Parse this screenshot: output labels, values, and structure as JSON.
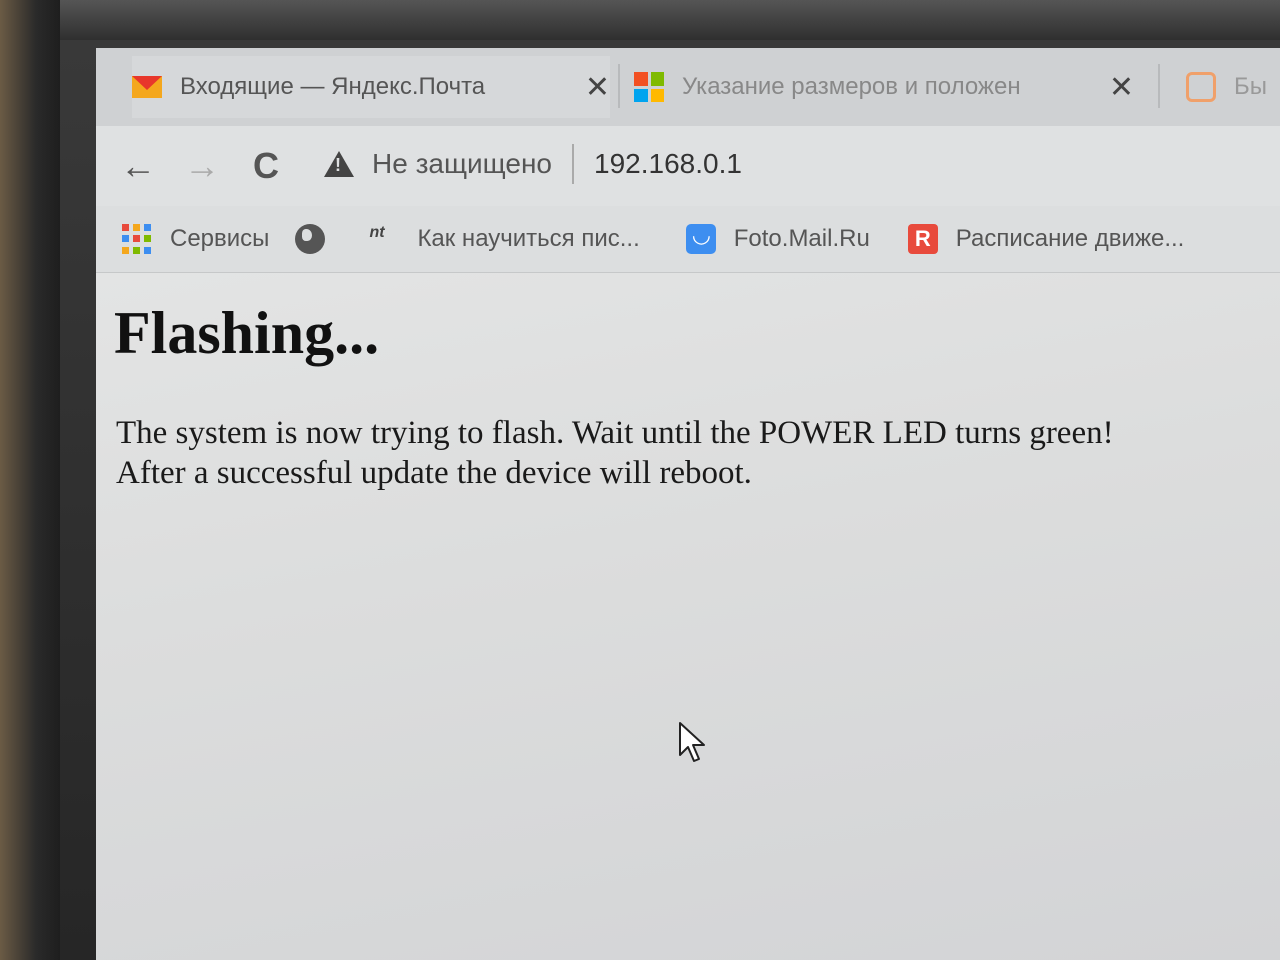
{
  "tabs": [
    {
      "title": "Входящие — Яндекс.Почта",
      "close": "✕",
      "icon": "yandex-mail-icon"
    },
    {
      "title": "Указание размеров и положен",
      "close": "✕",
      "icon": "microsoft-icon"
    },
    {
      "title": "Бы",
      "icon": "hand-icon"
    }
  ],
  "toolbar": {
    "back": "←",
    "forward": "→",
    "reload": "C",
    "security_label": "Не защищено",
    "url": "192.168.0.1"
  },
  "bookmarks": [
    {
      "label": "Сервисы",
      "icon": "apps-icon"
    },
    {
      "label": "",
      "icon": "globe-icon"
    },
    {
      "label": "Как научиться пис...",
      "icon": "nt-icon"
    },
    {
      "label": "Foto.Mail.Ru",
      "icon": "foto-mail-icon"
    },
    {
      "label": "Расписание движе...",
      "icon": "r-icon"
    }
  ],
  "page": {
    "heading": "Flashing...",
    "line1": "The system is now trying to flash. Wait until the POWER LED turns green!",
    "line2": "After a successful update the device will reboot."
  },
  "colors": {
    "mail_orange": "#f4a71d",
    "mail_red": "#e8372b",
    "ms_red": "#f25022",
    "ms_green": "#7fba00",
    "ms_blue": "#00a4ef",
    "ms_yellow": "#ffb900",
    "foto_blue": "#3d8ef0",
    "r_red": "#e84a3c"
  }
}
